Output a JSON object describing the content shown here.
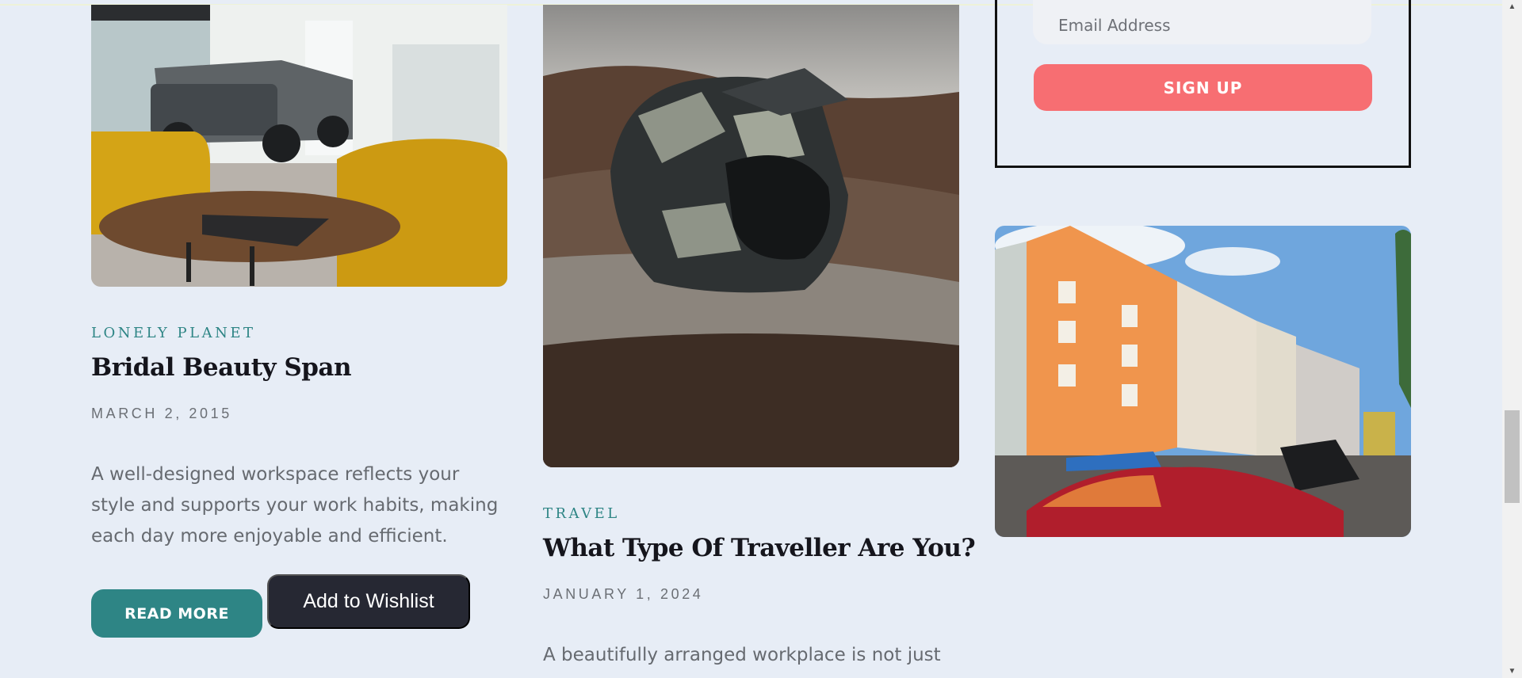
{
  "newsletter": {
    "email_placeholder": "Email Address",
    "signup_label": "SIGN UP"
  },
  "posts": [
    {
      "image": "office-showroom-photo",
      "category": "LONELY PLANET",
      "title": "Bridal Beauty Span",
      "date": "MARCH 2, 2015",
      "excerpt": "A well-designed workspace reflects your style and supports your work habits, making each day more enjoyable and efficient.",
      "read_more_label": "READ MORE",
      "wishlist_label": "Add to Wishlist"
    },
    {
      "image": "motorcycle-helmet-photo",
      "category": "TRAVEL",
      "title": "What Type Of Traveller Are You?",
      "date": "JANUARY 1, 2024",
      "excerpt": "A beautifully arranged workplace is not just"
    },
    {
      "image": "street-buildings-photo"
    }
  ],
  "colors": {
    "background": "#e7edf6",
    "accent_teal": "#2e8585",
    "signup_coral": "#f76e72",
    "wishlist_dark": "#262833"
  },
  "scrollbar": {
    "up_icon": "triangle-up-icon",
    "down_icon": "triangle-down-icon"
  }
}
